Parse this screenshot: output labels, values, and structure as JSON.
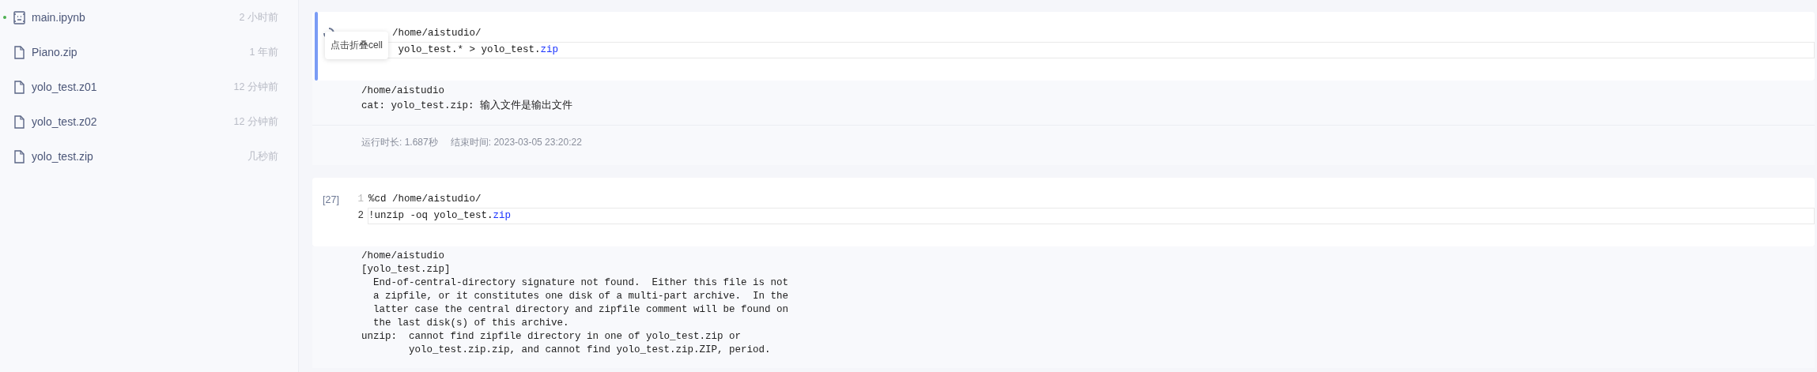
{
  "sidebar": {
    "files": [
      {
        "name": "main.ipynb",
        "time": "2 小时前",
        "kind": "notebook",
        "modified": true
      },
      {
        "name": "Piano.zip",
        "time": "1 年前",
        "kind": "file",
        "modified": false
      },
      {
        "name": "yolo_test.z01",
        "time": "12 分钟前",
        "kind": "file",
        "modified": false
      },
      {
        "name": "yolo_test.z02",
        "time": "12 分钟前",
        "kind": "file",
        "modified": false
      },
      {
        "name": "yolo_test.zip",
        "time": "几秒前",
        "kind": "file",
        "modified": false
      }
    ]
  },
  "cells": [
    {
      "active": true,
      "running": true,
      "tooltip": "点击折叠cell",
      "lines": [
        {
          "current": false,
          "segments": [
            {
              "text": "/home/aistudio/",
              "kind": "plain"
            }
          ]
        },
        {
          "current": true,
          "segments": [
            {
              "text": "yolo_test.* > yolo_test.",
              "kind": "plain"
            },
            {
              "text": "zip",
              "kind": "attr"
            }
          ]
        }
      ],
      "output": [
        "/home/aistudio",
        "cat: yolo_test.zip: 输入文件是输出文件"
      ],
      "timing": {
        "duration_label": "运行时长:",
        "duration": "1.687秒",
        "end_label": "结束时间:",
        "end": "2023-03-05 23:20:22"
      }
    },
    {
      "active": false,
      "running": false,
      "prompt": "[27]",
      "lines": [
        {
          "number": "1",
          "current": false,
          "segments": [
            {
              "text": "%cd /home/aistudio/",
              "kind": "plain"
            }
          ]
        },
        {
          "number": "2",
          "current": true,
          "segments": [
            {
              "text": "!unzip -oq yolo_test.",
              "kind": "plain"
            },
            {
              "text": "zip",
              "kind": "attr"
            }
          ]
        }
      ],
      "output": [
        "/home/aistudio",
        "[yolo_test.zip]",
        "  End-of-central-directory signature not found.  Either this file is not",
        "  a zipfile, or it constitutes one disk of a multi-part archive.  In the",
        "  latter case the central directory and zipfile comment will be found on",
        "  the last disk(s) of this archive.",
        "unzip:  cannot find zipfile directory in one of yolo_test.zip or",
        "        yolo_test.zip.zip, and cannot find yolo_test.zip.ZIP, period."
      ]
    }
  ]
}
